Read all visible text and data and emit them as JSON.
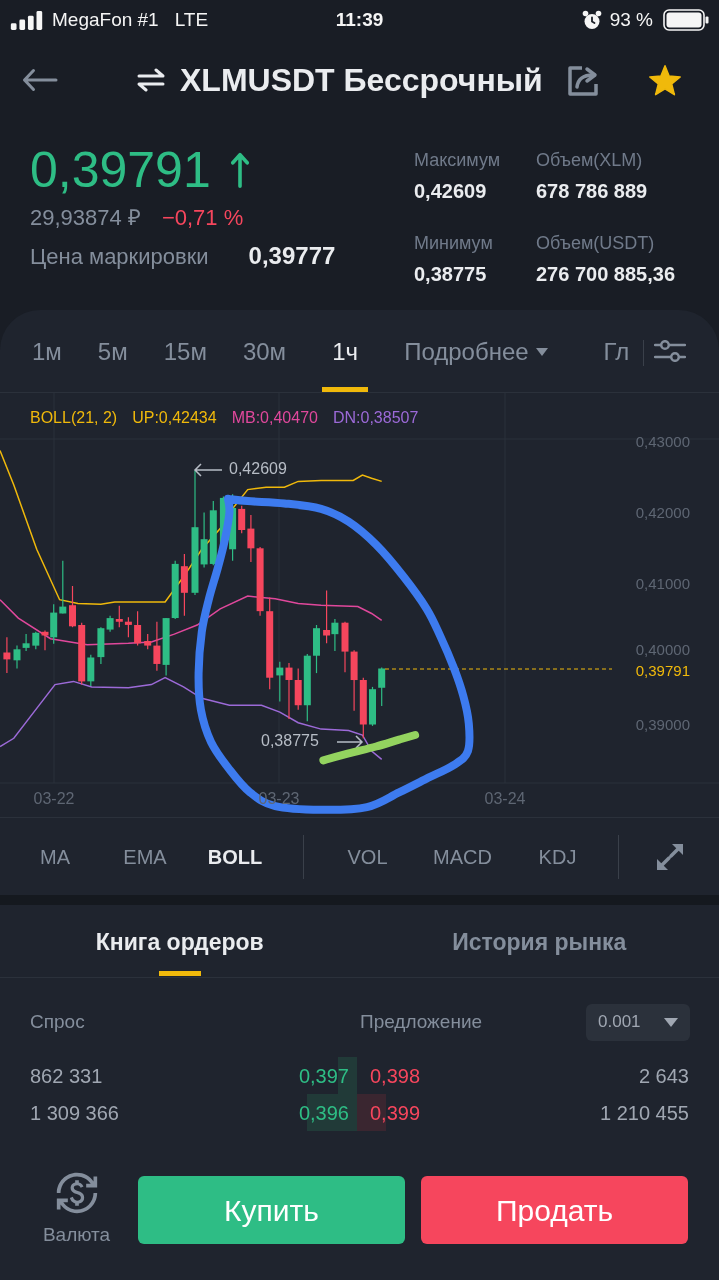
{
  "status_bar": {
    "carrier": "MegaFon #1",
    "network": "LTE",
    "time": "11:39",
    "battery": "93 %"
  },
  "header": {
    "title": "XLMUSDT Бессрочный",
    "favorite": true
  },
  "ticker": {
    "last_price": "0,39791",
    "rising": true,
    "fiat_price": "29,93874 ₽",
    "change": "−0,71 %",
    "mark_price_label": "Цена маркировки",
    "mark_price": "0,39777",
    "stats": [
      {
        "label": "Максимум",
        "value": "0,42609"
      },
      {
        "label": "Объем(XLM)",
        "value": "678 786 889"
      },
      {
        "label": "Минимум",
        "value": "0,38775"
      },
      {
        "label": "Объем(USDT)",
        "value": "276 700 885,36"
      }
    ]
  },
  "chart_tabs": {
    "intervals": [
      {
        "label": "1м",
        "selected": false
      },
      {
        "label": "5м",
        "selected": false
      },
      {
        "label": "15м",
        "selected": false
      },
      {
        "label": "30м",
        "selected": false
      },
      {
        "label": "1ч",
        "selected": true
      }
    ],
    "more_menu": "Подробнее",
    "next_tab": "Гл"
  },
  "chart": {
    "legend": [
      {
        "label": "BOLL(21, 2)",
        "color": "#f0b90b"
      },
      {
        "label": "UP:0,42434",
        "color": "#f0b90b"
      },
      {
        "label": "MB:0,40470",
        "color": "#e0489c"
      },
      {
        "label": "DN:0,38507",
        "color": "#9c6ad8"
      }
    ],
    "price_ticks": [
      "0,43000",
      "0,42000",
      "0,41000",
      "0,40000",
      "0,39000"
    ],
    "date_ticks": [
      "03-22",
      "03-23",
      "03-24"
    ],
    "high_marker": "0,42609",
    "low_marker": "0,38775",
    "last_price": "0,39791"
  },
  "indicators": {
    "main": [
      {
        "label": "MA",
        "selected": false
      },
      {
        "label": "EMA",
        "selected": false
      },
      {
        "label": "BOLL",
        "selected": true
      }
    ],
    "sub": [
      {
        "label": "VOL",
        "selected": false
      },
      {
        "label": "MACD",
        "selected": false
      },
      {
        "label": "KDJ",
        "selected": false
      }
    ]
  },
  "order_book": {
    "tabs": [
      {
        "label": "Книга ордеров",
        "selected": true
      },
      {
        "label": "История рынка",
        "selected": false
      }
    ],
    "bid_header": "Спрос",
    "ask_header": "Предложение",
    "precision": "0.001",
    "rows": [
      {
        "bid_qty": "862 331",
        "bid_price": "0,397",
        "ask_price": "0,398",
        "ask_qty": "2 643"
      },
      {
        "bid_qty": "1 309 366",
        "bid_price": "0,396",
        "ask_price": "0,399",
        "ask_qty": "1 210 455"
      }
    ]
  },
  "bottom_bar": {
    "currency_label": "Валюта",
    "buy": "Купить",
    "sell": "Продать"
  }
}
